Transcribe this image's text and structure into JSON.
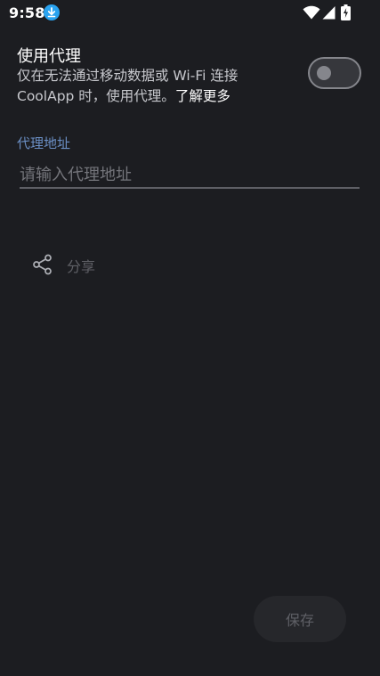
{
  "status_bar": {
    "time": "9:58",
    "icons": [
      "download-icon",
      "wifi-icon",
      "signal-icon",
      "battery-charging-icon"
    ]
  },
  "proxy": {
    "title": "使用代理",
    "description": "仅在无法通过移动数据或 Wi-Fi 连接 CoolApp 时，使用代理。",
    "learn_more": "了解更多",
    "enabled": false
  },
  "address": {
    "label": "代理地址",
    "value": "",
    "placeholder": "请输入代理地址"
  },
  "share": {
    "label": "分享",
    "icon": "share-icon"
  },
  "save": {
    "label": "保存"
  },
  "colors": {
    "background": "#1c1d21",
    "accent_label": "#6b8fc5",
    "disabled_text": "#5f6066"
  }
}
